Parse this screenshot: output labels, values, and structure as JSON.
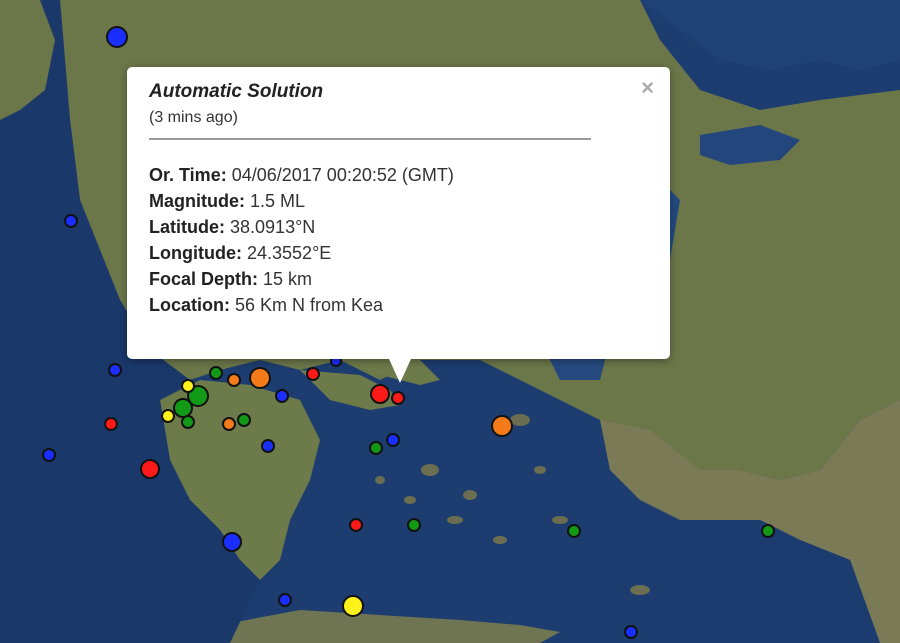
{
  "popup": {
    "title": "Automatic Solution",
    "subtitle": "(3 mins ago)",
    "close_icon": "×",
    "rows": [
      {
        "label": "Or. Time:",
        "value": "04/06/2017  00:20:52 (GMT)"
      },
      {
        "label": "Magnitude:",
        "value": "1.5 ML"
      },
      {
        "label": "Latitude:",
        "value": "38.0913°N"
      },
      {
        "label": "Longitude:",
        "value": "24.3552°E"
      },
      {
        "label": "Focal Depth:",
        "value": "15 km"
      },
      {
        "label": "Location:",
        "value": "56 Km N from Kea"
      }
    ]
  },
  "colors": {
    "sea": "#1b3a6b",
    "land": "#6f7a4e",
    "marker_blue": "#1a2eff",
    "marker_red": "#ff1a1a",
    "marker_green": "#129a16",
    "marker_orange": "#f47a1a",
    "marker_yellow": "#fff21a"
  },
  "markers": [
    {
      "color": "blue"
    },
    {
      "color": "blue"
    },
    {
      "color": "blue"
    },
    {
      "color": "blue"
    },
    {
      "color": "blue"
    },
    {
      "color": "blue"
    },
    {
      "color": "blue"
    },
    {
      "color": "blue"
    },
    {
      "color": "blue"
    },
    {
      "color": "blue"
    },
    {
      "color": "blue"
    },
    {
      "color": "blue"
    },
    {
      "color": "red"
    },
    {
      "color": "red"
    },
    {
      "color": "red"
    },
    {
      "color": "red"
    },
    {
      "color": "red"
    },
    {
      "color": "red"
    },
    {
      "color": "green"
    },
    {
      "color": "green"
    },
    {
      "color": "green"
    },
    {
      "color": "green"
    },
    {
      "color": "green"
    },
    {
      "color": "green"
    },
    {
      "color": "green"
    },
    {
      "color": "green"
    },
    {
      "color": "green"
    },
    {
      "color": "orange"
    },
    {
      "color": "orange"
    },
    {
      "color": "orange"
    },
    {
      "color": "orange"
    },
    {
      "color": "yellow"
    },
    {
      "color": "yellow"
    },
    {
      "color": "yellow"
    }
  ]
}
